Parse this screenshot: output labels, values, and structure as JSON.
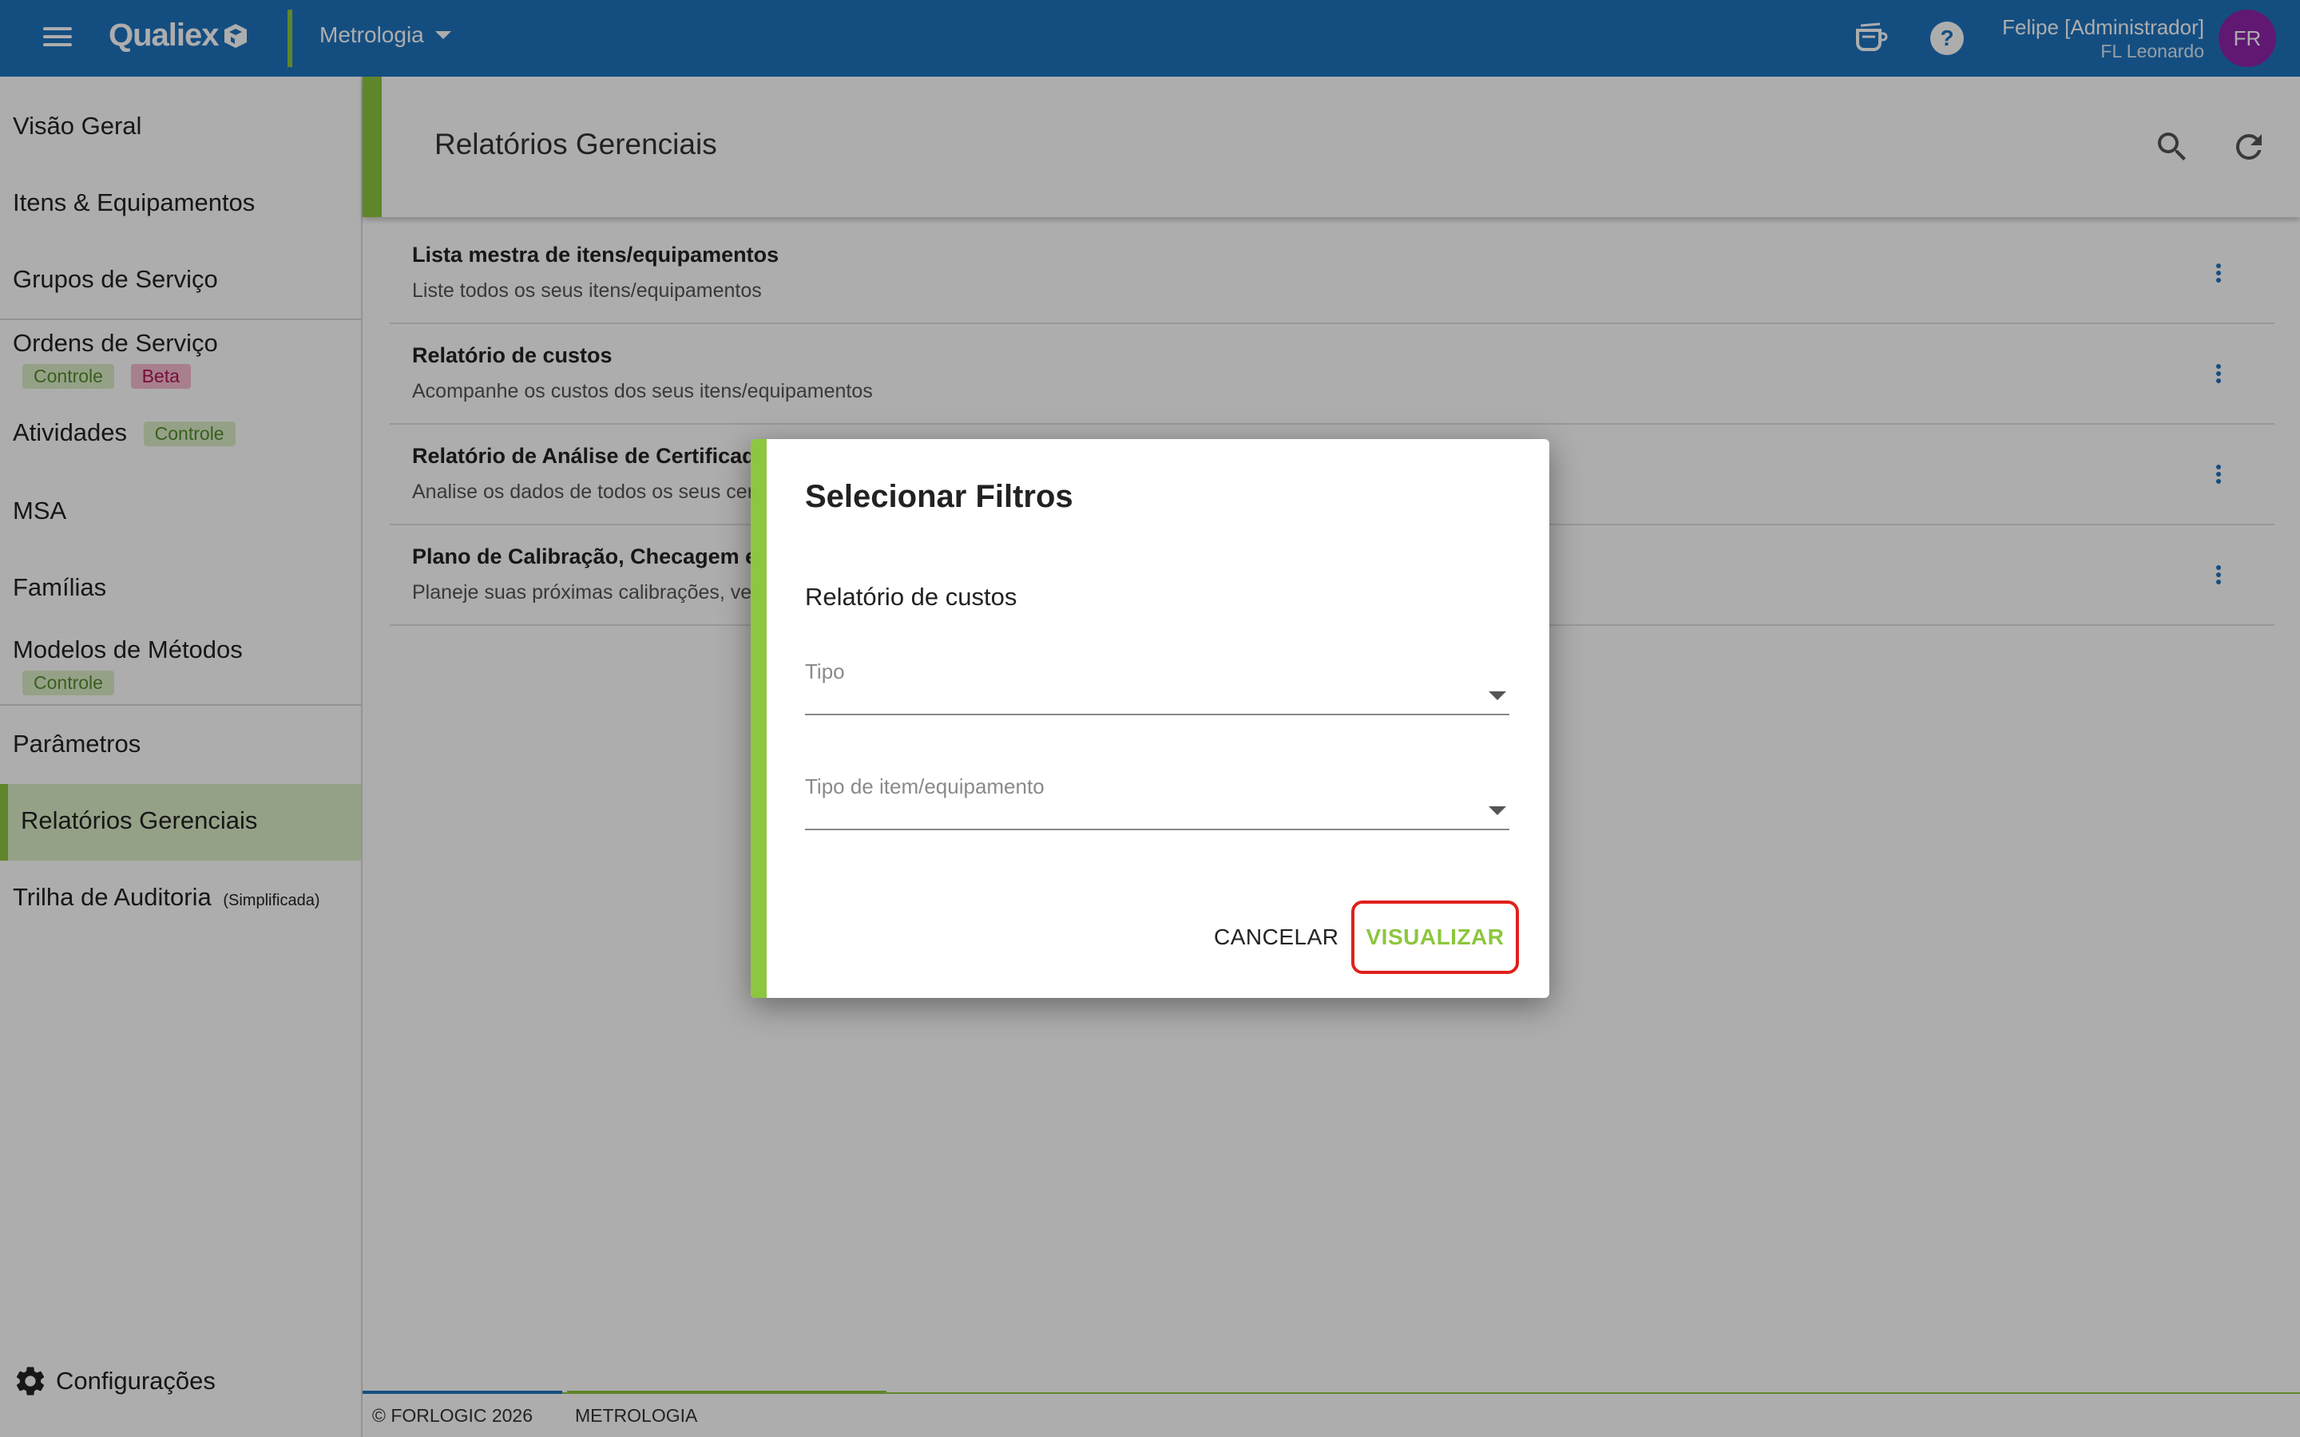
{
  "topbar": {
    "logo_text": "Qualiex",
    "module": "Metrologia",
    "user_name": "Felipe [Administrador]",
    "user_company": "FL Leonardo",
    "avatar_initials": "FR",
    "icons": [
      "menu-icon",
      "coffee-icon",
      "help-icon"
    ]
  },
  "sidebar": {
    "items": [
      {
        "label": "Visão Geral"
      },
      {
        "label": "Itens & Equipamentos"
      },
      {
        "label": "Grupos de Serviço"
      },
      {
        "label": "Ordens de Serviço",
        "badges": [
          "Controle",
          "Beta"
        ]
      },
      {
        "label": "Atividades",
        "badges": [
          "Controle"
        ]
      },
      {
        "label": "MSA"
      },
      {
        "label": "Famílias"
      },
      {
        "label": "Modelos de Métodos",
        "badges": [
          "Controle"
        ]
      },
      {
        "label": "Parâmetros"
      },
      {
        "label": "Relatórios Gerenciais",
        "active": true
      },
      {
        "label": "Trilha de Auditoria",
        "note": "(Simplificada)"
      }
    ],
    "settings_label": "Configurações"
  },
  "main": {
    "title": "Relatórios Gerenciais",
    "reports": [
      {
        "title": "Lista mestra de itens/equipamentos",
        "desc": "Liste todos os seus itens/equipamentos"
      },
      {
        "title": "Relatório de custos",
        "desc": "Acompanhe os custos dos seus itens/equipamentos"
      },
      {
        "title": "Relatório de Análise de Certificado",
        "desc": "Analise os dados de todos os seus cert"
      },
      {
        "title": "Plano de Calibração, Checagem e",
        "desc": "Planeje suas próximas calibrações, veri"
      }
    ]
  },
  "footer": {
    "copyright": "© FORLOGIC 2026",
    "module": "METROLOGIA"
  },
  "dialog": {
    "title": "Selecionar Filtros",
    "subtitle": "Relatório de custos",
    "field_tipo": "Tipo",
    "field_tipo_item": "Tipo de item/equipamento",
    "cancel_label": "CANCELAR",
    "view_label": "VISUALIZAR"
  },
  "colors": {
    "topbar": "#1e73be",
    "accent_green": "#8dc63f",
    "highlight_red": "#e0201c",
    "avatar": "#8e24aa"
  }
}
